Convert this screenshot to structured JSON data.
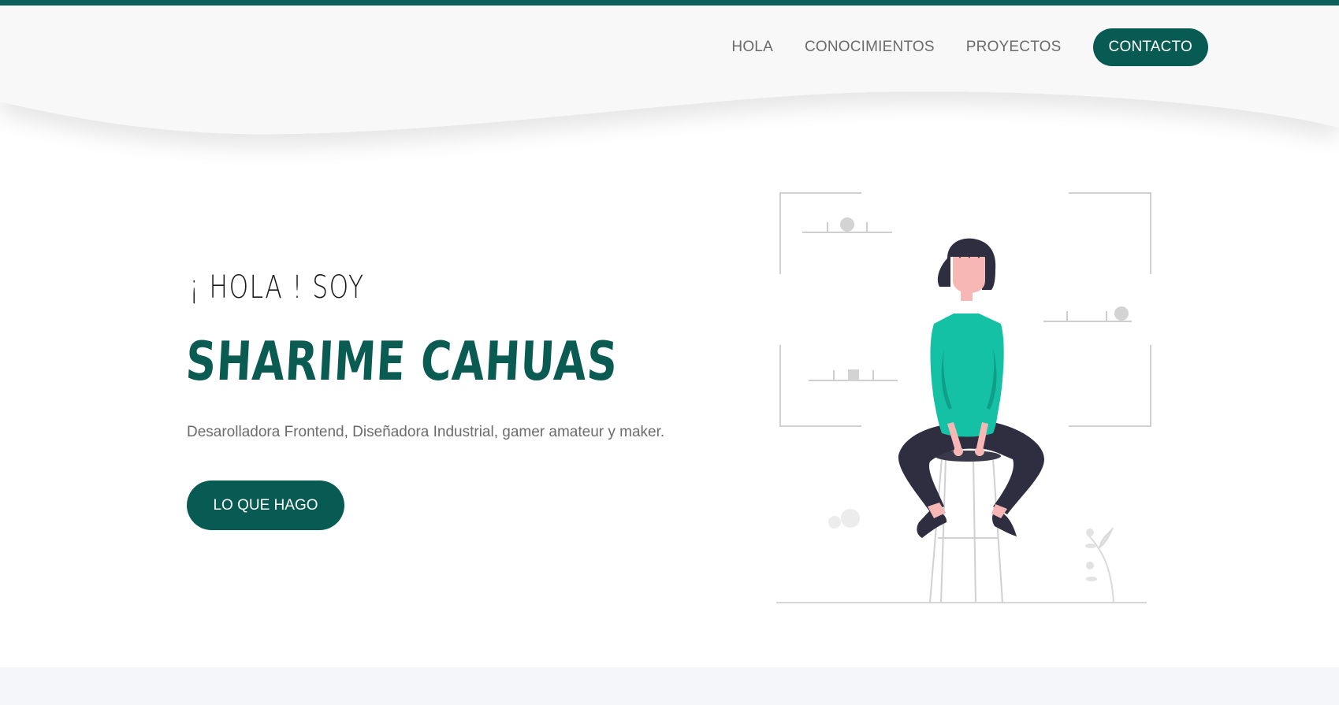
{
  "nav": {
    "items": [
      {
        "label": "HOLA"
      },
      {
        "label": "CONOCIMIENTOS"
      },
      {
        "label": "PROYECTOS"
      }
    ],
    "cta_label": "CONTACTO"
  },
  "hero": {
    "greeting": "¡ HOLA ! SOY",
    "name": "SHARIME CAHUAS",
    "description": "Desarolladora Frontend, Diseñadora Industrial, gamer amateur y maker.",
    "button_label": "LO QUE HAGO"
  },
  "colors": {
    "accent": "#085b52",
    "top_bar": "#0d5f5a",
    "shirt": "#14c1a5",
    "pants": "#2f2e41",
    "skin": "#f7b7b4",
    "header_bg": "#f8f8f8",
    "bottom_band": "#f5f6f9"
  },
  "illustration": {
    "icon": "person-on-stool-illustration"
  }
}
